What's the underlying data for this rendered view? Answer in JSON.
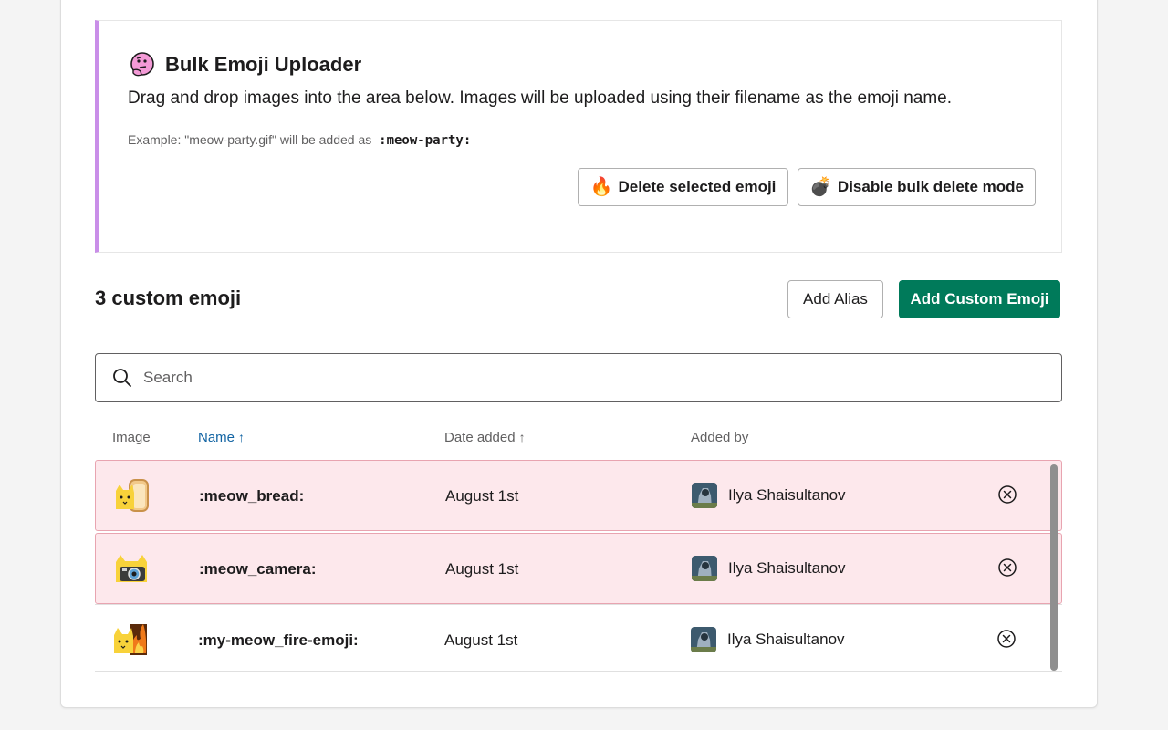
{
  "uploader": {
    "title": "Bulk Emoji Uploader",
    "description": "Drag and drop images into the area below. Images will be uploaded using their filename as the emoji name.",
    "example_prefix": "Example: \"meow-party.gif\" will be added as",
    "example_code": ":meow-party:",
    "delete_button": "Delete selected emoji",
    "disable_button": "Disable bulk delete mode",
    "delete_icon": "🔥",
    "disable_icon": "💣",
    "accent_color": "#c98ee8"
  },
  "section": {
    "count_title": "3 custom emoji",
    "add_alias": "Add Alias",
    "add_custom": "Add Custom Emoji",
    "primary_color": "#007a5a"
  },
  "search": {
    "placeholder": "Search",
    "value": ""
  },
  "table": {
    "headers": {
      "image": "Image",
      "name": "Name",
      "date": "Date added",
      "added_by": "Added by"
    },
    "rows": [
      {
        "name": ":meow_bread:",
        "date": "August 1st",
        "user": "Ilya Shaisultanov",
        "selected": true,
        "icon": "meow-bread-emoji"
      },
      {
        "name": ":meow_camera:",
        "date": "August 1st",
        "user": "Ilya Shaisultanov",
        "selected": true,
        "icon": "meow-camera-emoji"
      },
      {
        "name": ":my-meow_fire-emoji:",
        "date": "August 1st",
        "user": "Ilya Shaisultanov",
        "selected": false,
        "icon": "meow-fire-emoji"
      }
    ]
  }
}
